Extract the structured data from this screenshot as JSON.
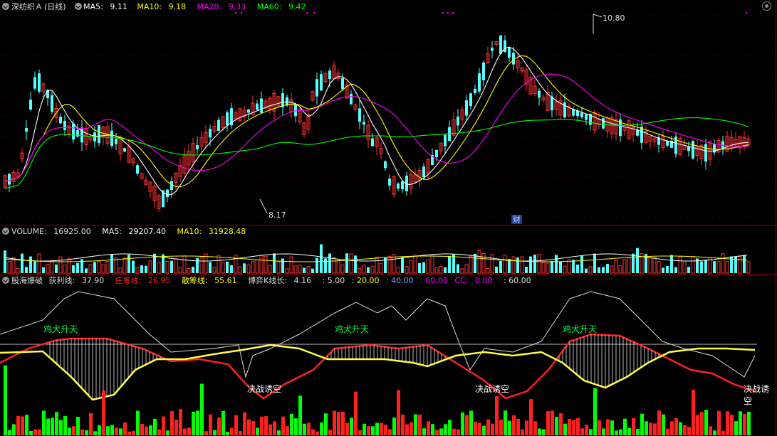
{
  "main": {
    "title": "深纺织Ａ",
    "period": "(日线)",
    "ma5_label": "MA5:",
    "ma5": "9.11",
    "ma10_label": "MA10:",
    "ma10": "9.18",
    "ma20_label": "MA20:",
    "ma20": "9.33",
    "ma60_label": "MA60:",
    "ma60": "9.42",
    "high_mark": "10.80",
    "low_mark": "8.17",
    "finance_badge": "财",
    "colors": {
      "up": "#ff3232",
      "down": "#54ffff",
      "ma5": "#ffffff",
      "ma10": "#ffff00",
      "ma20": "#ff00ff",
      "ma60": "#00ff00"
    }
  },
  "volume": {
    "label": "VOLUME:",
    "value": "16925.00",
    "ma5_label": "MA5:",
    "ma5": "29207.40",
    "ma10_label": "MA10:",
    "ma10": "31928.48"
  },
  "indicator": {
    "name": "股海爆破",
    "profit_label": "获利线:",
    "profit": "37.90",
    "zhuang_label": "庄筹线:",
    "zhuang": "26.95",
    "san_label": "散筹线:",
    "san": "55.61",
    "boyi_label": "博弈K线长:",
    "boyi": "4.16",
    "v1": ": 5.00",
    "v2": ": 20.00",
    "v3": ": 40.00",
    "v4": ": 60.00",
    "cc_label": "CC:",
    "cc": "0.00",
    "v5": ": 60.00",
    "rise_labels": [
      "鸡犬升天",
      "鸡犬升天",
      "鸡犬升天"
    ],
    "fall_labels": [
      "决战诱空",
      "决战诱空",
      "决战诱空"
    ]
  }
}
